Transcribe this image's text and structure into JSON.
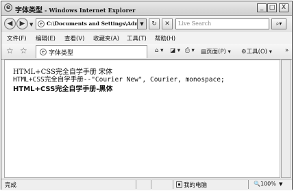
{
  "window": {
    "title": "字体类型",
    "title_app": " - Windows Internet Explorer",
    "minimize_label": "_",
    "maximize_label": "□",
    "close_label": "X"
  },
  "address": {
    "url": "C:\\Documents and Settings\\Adm",
    "search_placeholder": "Live Search"
  },
  "menu": {
    "items": [
      "文件(F)",
      "编辑(E)",
      "查看(V)",
      "收藏夹(A)",
      "工具(T)",
      "帮助(H)"
    ]
  },
  "tab": {
    "label": "字体类型"
  },
  "commands": {
    "page": "页面(P)",
    "tools": "工具(O)"
  },
  "content": {
    "line1": "HTML+CSS完全自学手册 宋体",
    "line2": "HTML+CSS完全自学手册--\"Courier New\", Courier, monospace;",
    "line3": "HTML+CSS完全自学手册-黑体"
  },
  "status": {
    "text": "完成",
    "zone": "我的电脑",
    "zoom": "100%"
  }
}
